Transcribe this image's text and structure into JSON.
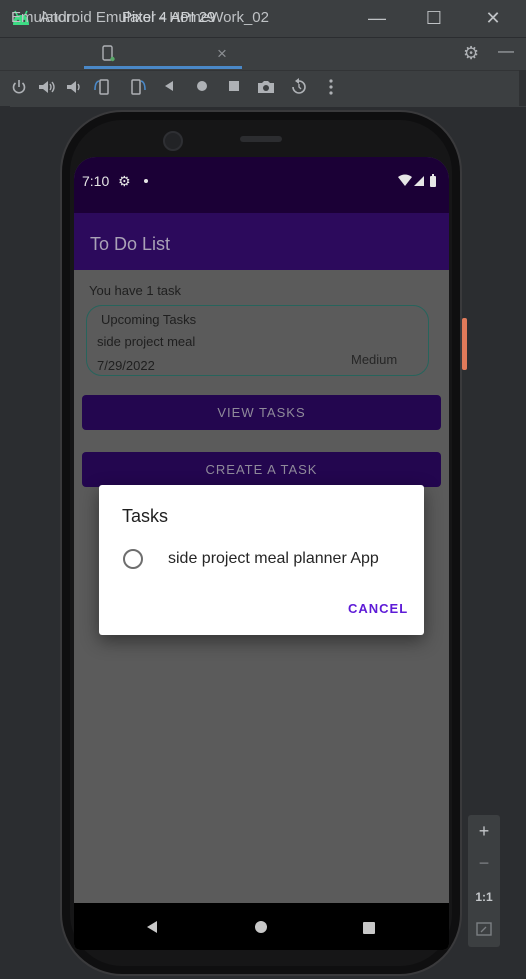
{
  "window": {
    "title": "Android Emulator - HomeWork_02",
    "controls": {
      "minimize": "—",
      "maximize": "☐",
      "close": "✕"
    }
  },
  "tabbar": {
    "emulator_label": "Emulator:",
    "device_tab_label": "Pixel 4 API 29",
    "tab_close": "×",
    "settings_icon": "⚙",
    "hide_icon": "—"
  },
  "toolbar": {
    "icons": [
      "power-icon",
      "volume-up-icon",
      "volume-down-icon",
      "rotate-left-icon",
      "rotate-right-icon",
      "back-icon",
      "home-icon",
      "overview-icon",
      "screenshot-icon",
      "snapshot-icon",
      "more-icon"
    ]
  },
  "phone": {
    "status": {
      "time": "7:10"
    },
    "app": {
      "title": "To Do List",
      "task_count": "You have 1 task",
      "card": {
        "heading": "Upcoming Tasks",
        "task_name": "side project meal",
        "date": "7/29/2022",
        "priority": "Medium"
      },
      "view_button": "VIEW TASKS",
      "create_button": "CREATE A TASK"
    },
    "dialog": {
      "title": "Tasks",
      "options": [
        "side project meal planner App"
      ],
      "cancel": "CANCEL"
    }
  },
  "zoom_panel": {
    "zoom_in": "+",
    "zoom_out": "−",
    "ratio": "1:1"
  },
  "colors": {
    "status_bar": "#1b0036",
    "app_bar": "#2c0a5c",
    "button": "#23064f",
    "dialog_accent": "#5e1bd7",
    "card_border": "#27645c",
    "tab_accent": "#4a88c7"
  }
}
